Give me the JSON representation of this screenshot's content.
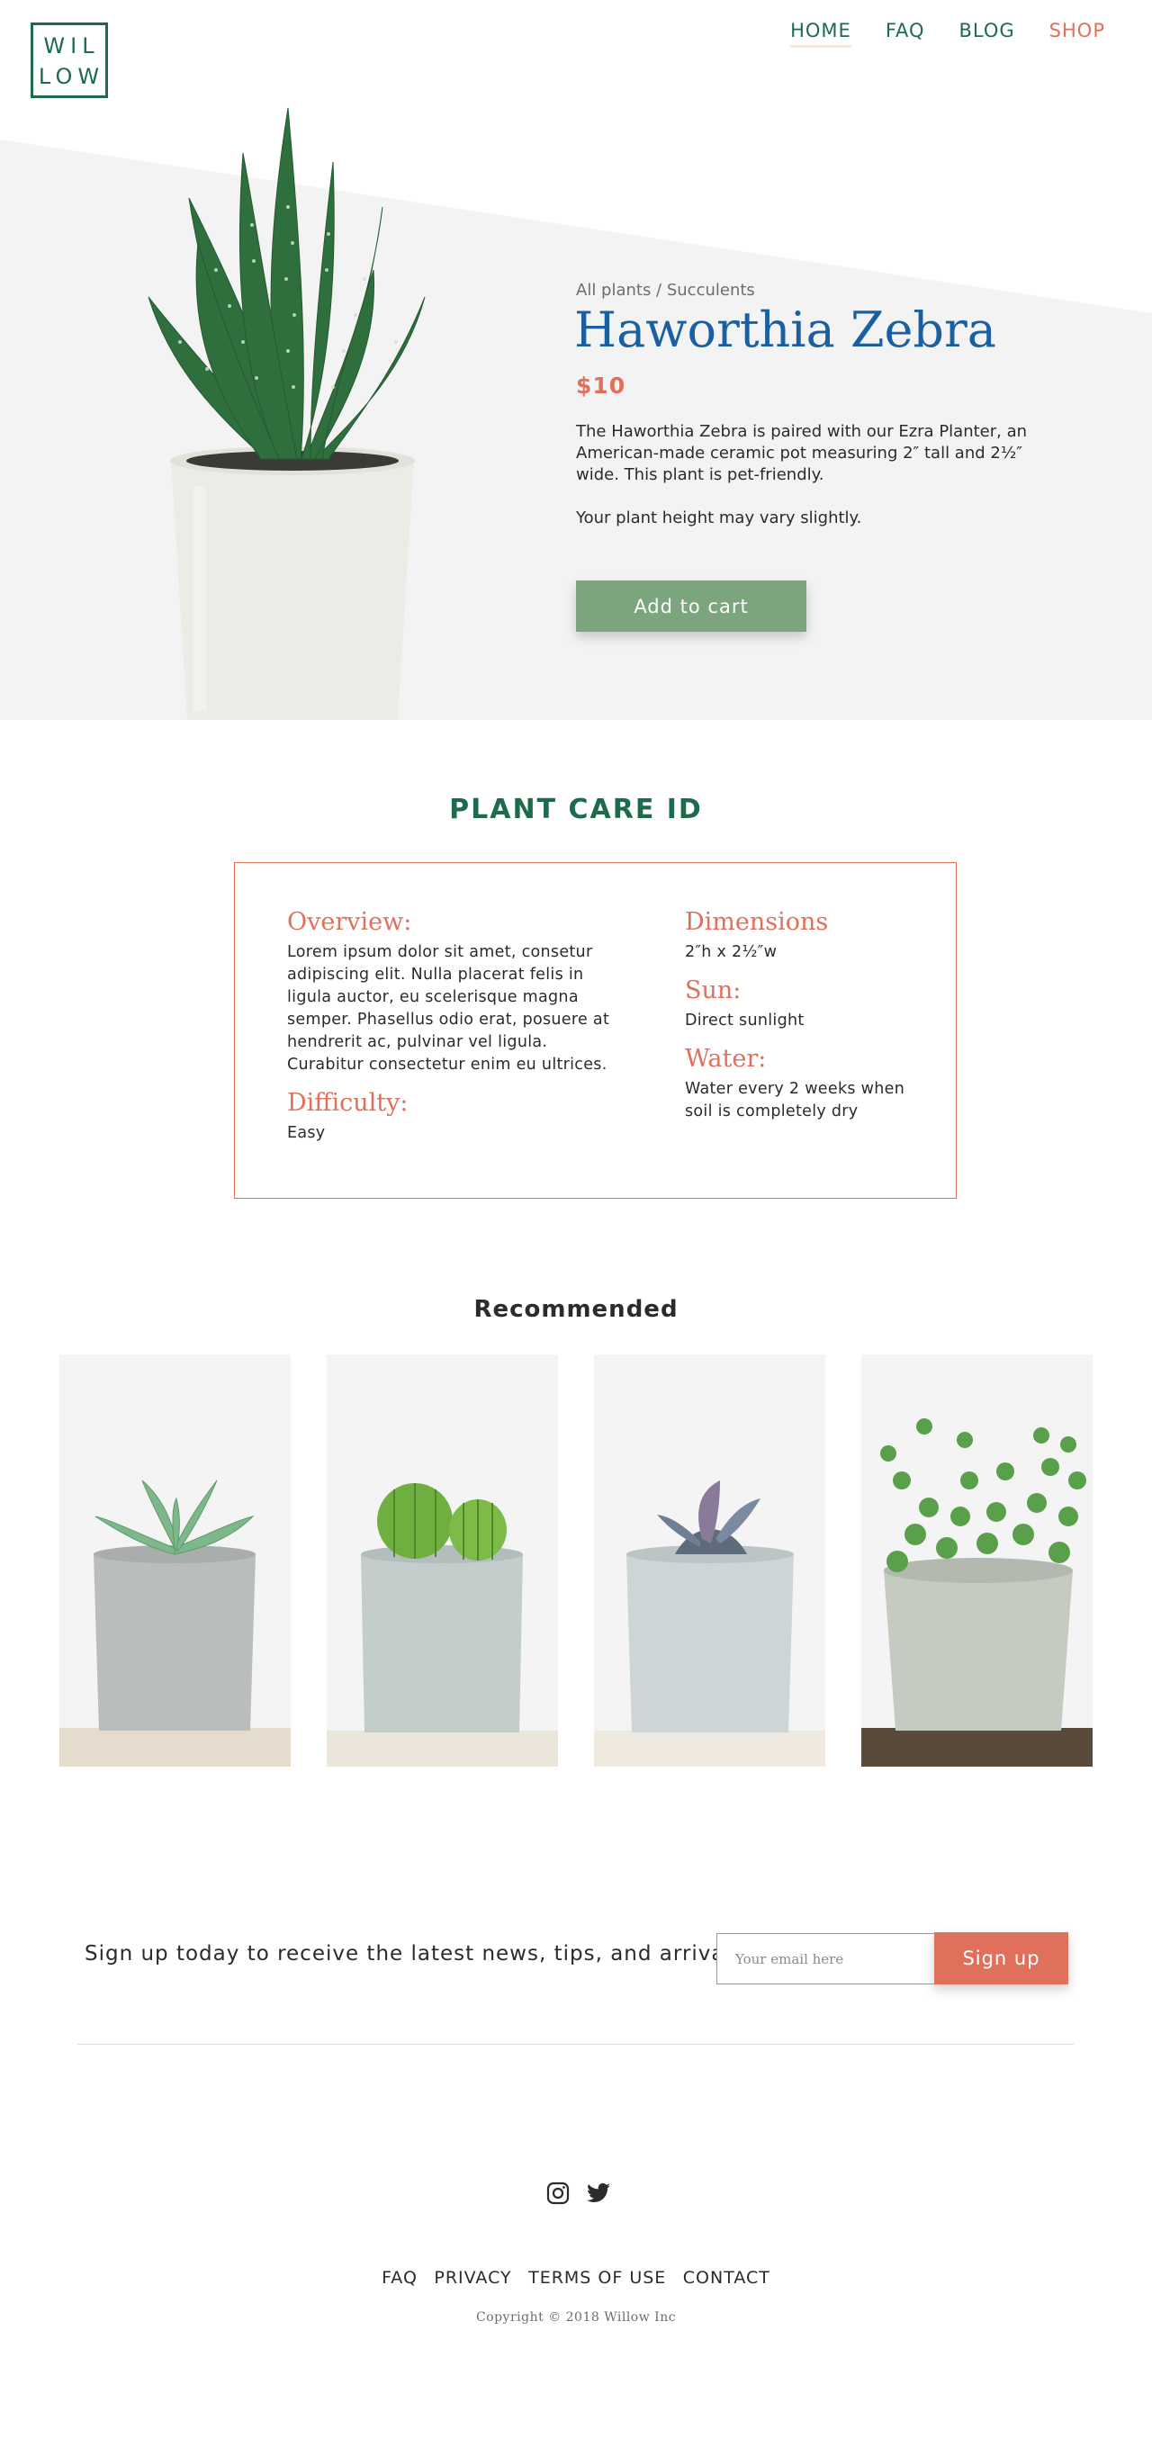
{
  "brand": {
    "logo_line1": "WIL",
    "logo_line2": "LOW"
  },
  "nav": {
    "items": [
      {
        "label": "HOME"
      },
      {
        "label": "FAQ"
      },
      {
        "label": "BLOG"
      },
      {
        "label": "SHOP"
      }
    ]
  },
  "product": {
    "breadcrumb": "All plants / Succulents",
    "name": "Haworthia Zebra",
    "price": "$10",
    "description": "The Haworthia Zebra is paired with our Ezra Planter, an American-made ceramic pot measuring 2″ tall and 2½″ wide. This plant is pet-friendly.",
    "note": "Your plant height may vary slightly.",
    "add_to_cart_label": "Add to cart"
  },
  "care": {
    "heading": "PLANT CARE ID",
    "overview_label": "Overview:",
    "overview_text": "Lorem ipsum dolor sit amet, consetur adipiscing elit. Nulla placerat felis in ligula auctor, eu scelerisque magna semper. Phasellus odio erat, posuere at hendrerit ac, pulvinar vel ligula. Curabitur consectetur enim eu ultrices.",
    "difficulty_label": "Difficulty:",
    "difficulty_text": "Easy",
    "dimensions_label": "Dimensions",
    "dimensions_text": "2″h x 2½″w",
    "sun_label": "Sun:",
    "sun_text": "Direct sunlight",
    "water_label": "Water:",
    "water_text": "Water every 2 weeks when soil is completely dry"
  },
  "recommended": {
    "heading": "Recommended"
  },
  "newsletter": {
    "text": "Sign up today to receive the latest news, tips, and arrivals",
    "email_placeholder": "Your email here",
    "signup_label": "Sign up"
  },
  "footer": {
    "links": [
      "FAQ",
      "PRIVACY",
      "TERMS OF USE",
      "CONTACT"
    ],
    "copyright": "Copyright © 2018 Willow Inc",
    "social_icons": [
      "instagram-icon",
      "twitter-icon"
    ]
  },
  "colors": {
    "brand_green": "#1e6b4b",
    "accent_coral": "#e0705c",
    "title_blue": "#1b5fa3",
    "button_green": "#7aa57d",
    "hero_grey": "#f3f3f3"
  }
}
